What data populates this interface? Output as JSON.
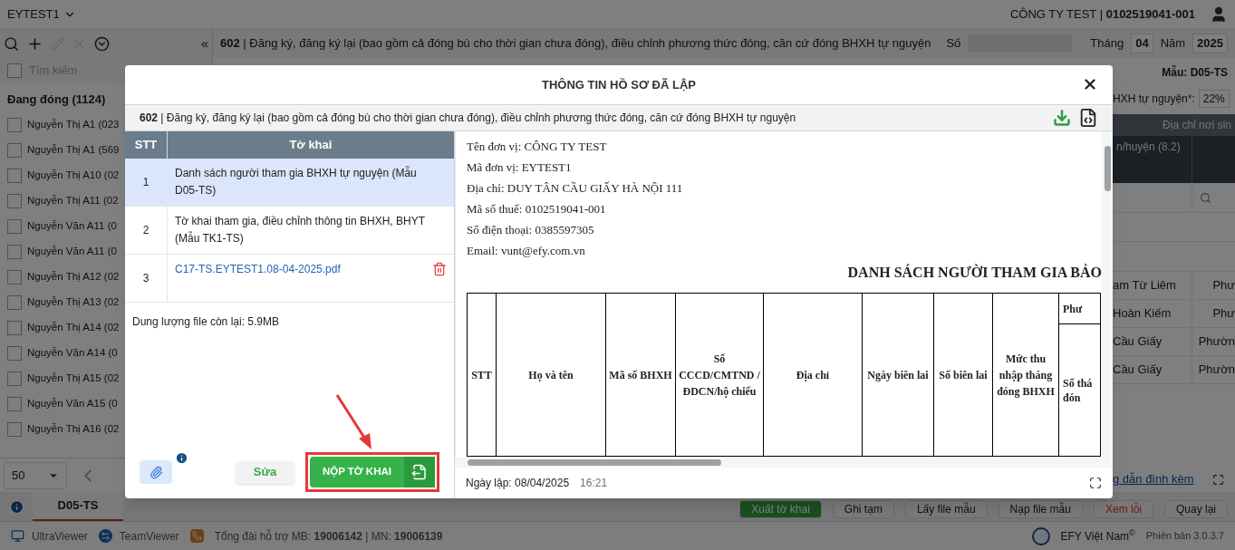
{
  "app": {
    "unit": "EYTEST1",
    "company": "CÔNG TY TEST | **0102519041-001**"
  },
  "toolbar": {
    "collapse": "«",
    "procedure": "**602** | Đăng ký, đăng ký lại (bao gồm cả đóng bù cho thời gian chưa đóng), điều chỉnh phương thức đóng, căn cứ đóng BHXH tự nguyện",
    "number_label": "Số",
    "month_label": "Tháng",
    "month": "04",
    "year_label": "Năm",
    "year": "2025"
  },
  "sidebar": {
    "select_all_checked": false,
    "search_placeholder": "Tìm kiếm",
    "group": "Đang đóng (1124)",
    "page_size": "50",
    "items": [
      {
        "name": "Nguyễn Thị A1 (023",
        "checked": false
      },
      {
        "name": "Nguyễn Thị A1 (569",
        "checked": false
      },
      {
        "name": "Nguyễn Thị A10 (02",
        "checked": false
      },
      {
        "name": "Nguyễn Thị A11 (02",
        "checked": false
      },
      {
        "name": "Nguyễn Văn A11 (0",
        "checked": false
      },
      {
        "name": "Nguyễn Văn A11 (0",
        "checked": false
      },
      {
        "name": "Nguyễn Thị A12 (02",
        "checked": false
      },
      {
        "name": "Nguyễn Thị A13 (02",
        "checked": false
      },
      {
        "name": "Nguyễn Thị A14 (02",
        "checked": false
      },
      {
        "name": "Nguyễn Văn A14 (0",
        "checked": false
      },
      {
        "name": "Nguyễn Thị A15 (02",
        "checked": false
      },
      {
        "name": "Nguyễn Văn A15 (0",
        "checked": false
      },
      {
        "name": "Nguyễn Thị A16 (02",
        "checked": false
      }
    ]
  },
  "bottom_tabs": [
    {
      "label": "D05-TS",
      "selected": true
    }
  ],
  "right_panel": {
    "form": "Mẫu: D05-TS",
    "rate_label": "HXH tự nguyện",
    "rate_mark": "*",
    "rate_colon": ":",
    "rate": "22%",
    "group_header": "Địa chỉ nơi sin",
    "column": "n/huyện (8.2)",
    "rows": [
      [
        "am Từ Liêm",
        "Phư"
      ],
      [
        "Hoàn Kiếm",
        "Phư"
      ],
      [
        "Cầu Giấy",
        "Phườn"
      ],
      [
        "Cầu Giấy",
        "Phườn"
      ]
    ],
    "guide_link": "g dẫn đính kèm"
  },
  "actions": [
    {
      "label": "Xuất tờ khai",
      "kind": "primary"
    },
    {
      "label": "Ghi tạm",
      "kind": "plain"
    },
    {
      "label": "Lấy file mẫu",
      "kind": "plain"
    },
    {
      "label": "Nạp file mẫu",
      "kind": "plain"
    },
    {
      "label": "Xem lỗi",
      "kind": "danger"
    },
    {
      "label": "Quay lại",
      "kind": "plain"
    }
  ],
  "dialog": {
    "title": "THÔNG TIN HỒ SƠ ĐÃ LẬP",
    "procedure": "**602** | Đăng ký, đăng ký lại (bao gồm cả đóng bù cho thời gian chưa đóng), điều chỉnh phương thức đóng, căn cứ đóng BHXH tự nguyện",
    "columns": [
      "STT",
      "Tờ khai"
    ],
    "rows": [
      {
        "stt": "1",
        "name": "Danh sách người tham gia BHXH tự nguyện (Mẫu D05-TS)",
        "selected": true,
        "kind": "form"
      },
      {
        "stt": "2",
        "name": "Tờ khai tham gia, điều chỉnh thông tin BHXH, BHYT (Mẫu TK1-TS)",
        "selected": false,
        "kind": "form"
      },
      {
        "stt": "3",
        "name": "C17-TS.EYTEST1.08-04-2025.pdf",
        "selected": false,
        "kind": "attachment"
      }
    ],
    "remaining": "Dung lượng file còn lại: 5.9MB",
    "edit_button": "Sửa",
    "submit_button": "NỘP TỜ KHAI",
    "document": {
      "lines": [
        "Tên đơn vị: CÔNG TY TEST",
        "Mã đơn vị: EYTEST1",
        "Địa chỉ: DUY TÂN CẦU GIẤY HÀ NỘI 111",
        "Mã số thuế: 0102519041-001",
        "Số điện thoại: 0385597305",
        "Email: vunt@efy.com.vn"
      ],
      "title": "DANH SÁCH NGƯỜI THAM GIA BẢO",
      "columns": [
        "STT",
        "Họ và tên",
        "Mã số BHXH",
        "Số CCCD/CMTND / ĐDCN/hộ chiếu",
        "Địa chỉ",
        "Ngày biên lai",
        "Số biên lai",
        "Mức thu nhập tháng đóng BHXH"
      ],
      "last_group": "Phư",
      "last_column": "Số thá đón"
    },
    "created_label": "Ngày lập: 08/04/2025",
    "created_time": "16:21"
  },
  "status_bar": {
    "tools": [
      {
        "label": "UltraViewer",
        "kind": "monitor"
      },
      {
        "label": "TeamViewer",
        "kind": "arrows"
      }
    ],
    "hotline": "Tổng đài hỗ trợ MB: **19006142** | MN: **19006139**",
    "brand": "EFY Việt Nam",
    "copyright": "©",
    "version": "Phiên bản 3.0.3.7"
  }
}
